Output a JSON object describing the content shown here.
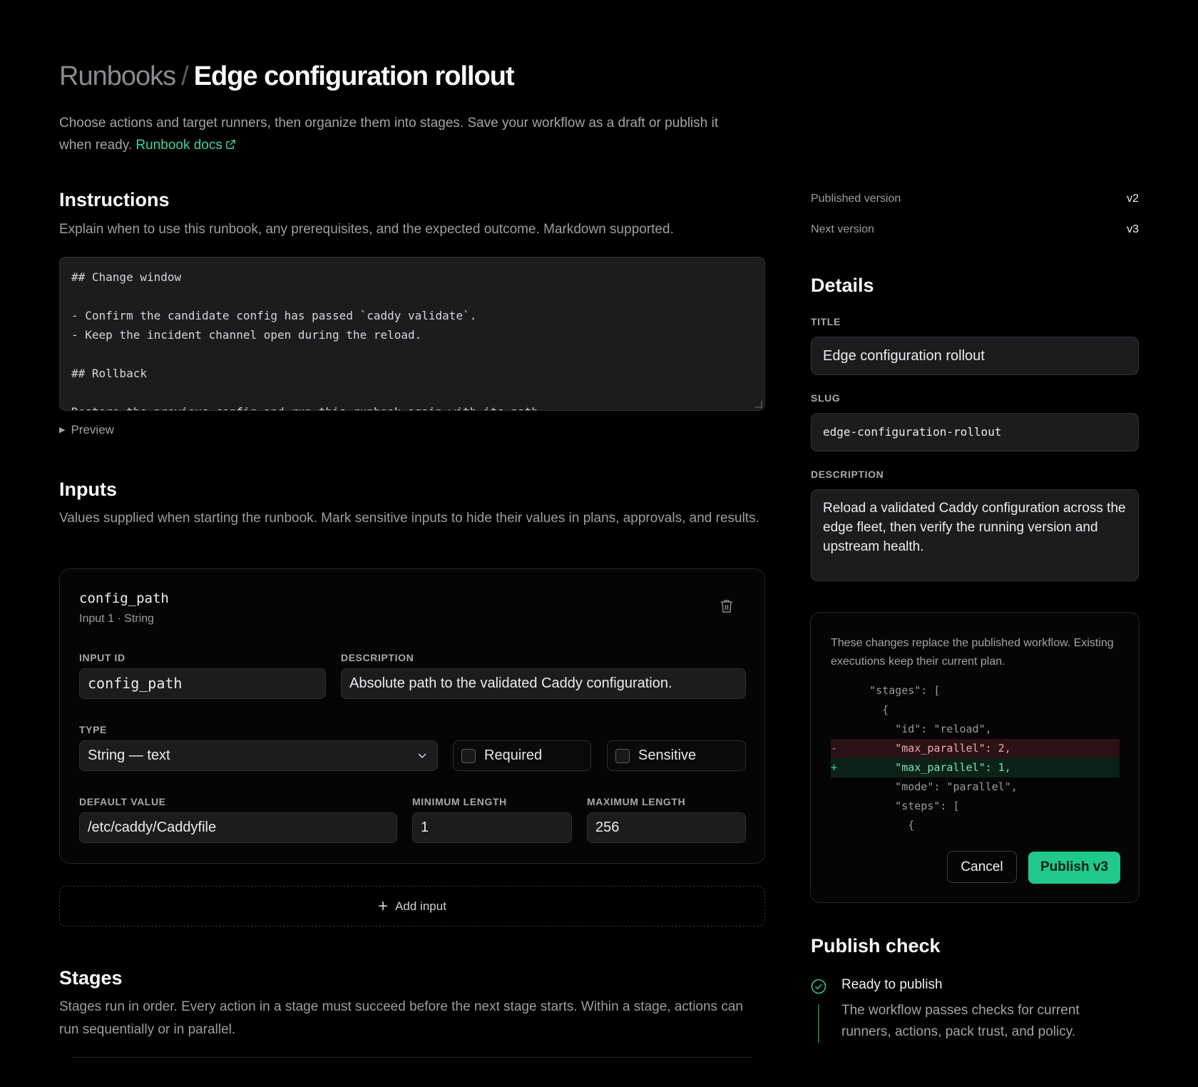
{
  "header": {
    "breadcrumb_root": "Runbooks",
    "breadcrumb_sep": "/",
    "title": "Edge configuration rollout",
    "intro_text": "Choose actions and target runners, then organize them into stages. Save your workflow as a draft or publish it when ready.",
    "docs_link": "Runbook docs"
  },
  "instructions": {
    "heading": "Instructions",
    "subtitle": "Explain when to use this runbook, any prerequisites, and the expected outcome. Markdown supported.",
    "content": "## Change window\n\n- Confirm the candidate config has passed `caddy validate`.\n- Keep the incident channel open during the reload.\n\n## Rollback\n\nRestore the previous config and run this runbook again with its path.",
    "preview_label": "Preview"
  },
  "inputs": {
    "heading": "Inputs",
    "subtitle": "Values supplied when starting the runbook. Mark sensitive inputs to hide their values in plans, approvals, and results.",
    "items": [
      {
        "name": "config_path",
        "meta": "Input 1 · String",
        "input_id_label": "INPUT ID",
        "input_id": "config_path",
        "description_label": "DESCRIPTION",
        "description": "Absolute path to the validated Caddy configuration.",
        "type_label": "TYPE",
        "type": "String — text",
        "required_label": "Required",
        "sensitive_label": "Sensitive",
        "default_label": "DEFAULT VALUE",
        "default_value": "/etc/caddy/Caddyfile",
        "min_label": "MINIMUM LENGTH",
        "min_value": "1",
        "max_label": "MAXIMUM LENGTH",
        "max_value": "256"
      }
    ],
    "add_label": "Add input"
  },
  "stages": {
    "heading": "Stages",
    "subtitle": "Stages run in order. Every action in a stage must succeed before the next stage starts. Within a stage, actions can run sequentially or in parallel."
  },
  "versions": {
    "published_label": "Published version",
    "published_value": "v2",
    "next_label": "Next version",
    "next_value": "v3"
  },
  "details": {
    "heading": "Details",
    "title_label": "TITLE",
    "title_value": "Edge configuration rollout",
    "slug_label": "SLUG",
    "slug_value": "edge-configuration-rollout",
    "description_label": "DESCRIPTION",
    "description_value": "Reload a validated Caddy configuration across the edge fleet, then verify the running version and upstream health."
  },
  "publish_dialog": {
    "note": "These changes replace the published workflow. Existing executions keep their current plan.",
    "diff": [
      {
        "kind": "ctx",
        "marker": "",
        "text": "  \"stages\": ["
      },
      {
        "kind": "ctx",
        "marker": "",
        "text": "    {"
      },
      {
        "kind": "ctx",
        "marker": "",
        "text": "      \"id\": \"reload\","
      },
      {
        "kind": "del",
        "marker": "-",
        "text": "      \"max_parallel\": 2,"
      },
      {
        "kind": "add",
        "marker": "+",
        "text": "      \"max_parallel\": 1,"
      },
      {
        "kind": "ctx",
        "marker": "",
        "text": "      \"mode\": \"parallel\","
      },
      {
        "kind": "ctx",
        "marker": "",
        "text": "      \"steps\": ["
      },
      {
        "kind": "ctx",
        "marker": "",
        "text": "        {"
      }
    ],
    "cancel_label": "Cancel",
    "publish_label": "Publish v3"
  },
  "publish_check": {
    "heading": "Publish check",
    "status": "Ready to publish",
    "detail": "The workflow passes checks for current runners, actions, pack trust, and policy."
  },
  "colors": {
    "accent": "#20c98b",
    "link": "#3ed59a",
    "background": "#000000",
    "surface": "#1c1c1f"
  }
}
